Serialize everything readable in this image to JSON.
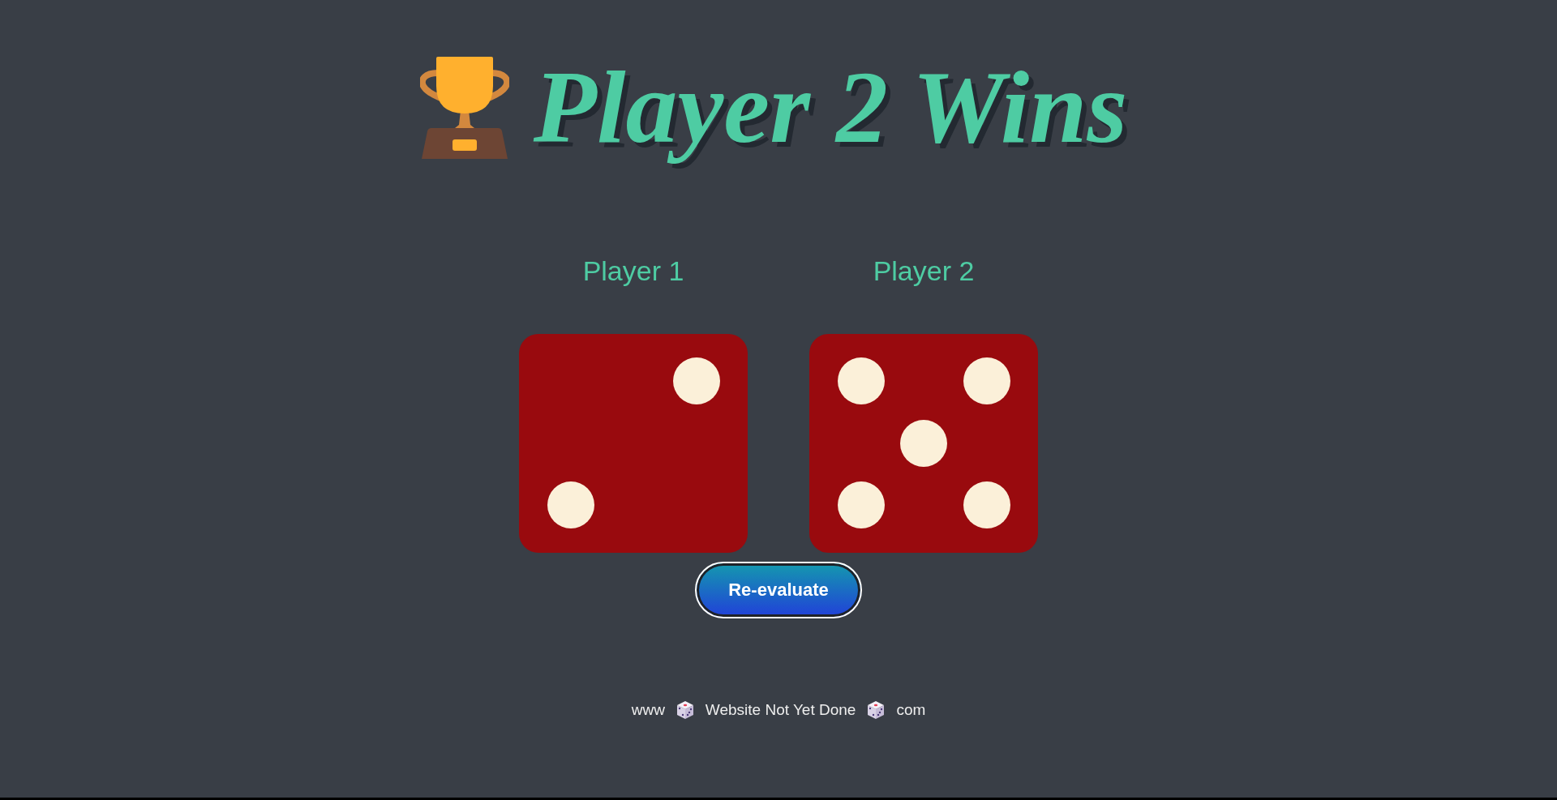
{
  "title": "Player 2 Wins",
  "players": [
    {
      "label": "Player 1",
      "kind": "two"
    },
    {
      "label": "Player 2",
      "kind": "five"
    }
  ],
  "button": "Re-evaluate",
  "footer": {
    "left": "www",
    "middle": "Website Not Yet Done",
    "right": "com"
  }
}
